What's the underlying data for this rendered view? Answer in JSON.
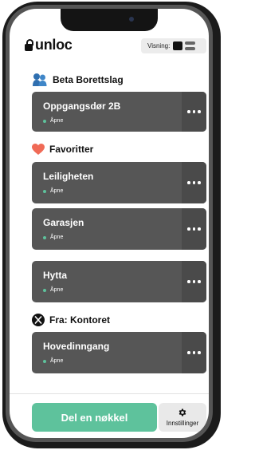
{
  "app": {
    "logo_text": "unloc"
  },
  "view_toggle": {
    "label": "Visning:",
    "selected": "grid"
  },
  "sections": [
    {
      "title": "Beta Borettslag",
      "icon": "people-icon",
      "cards": [
        {
          "name": "Oppgangsdør 2B",
          "status": "Åpne"
        }
      ]
    },
    {
      "title": "Favoritter",
      "icon": "heart-icon",
      "cards": [
        {
          "name": "Leiligheten",
          "status": "Åpne"
        },
        {
          "name": "Garasjen",
          "status": "Åpne"
        },
        {
          "name": "Hytta",
          "status": "Åpne"
        }
      ]
    },
    {
      "title": "Fra: Kontoret",
      "icon": "company-logo-icon",
      "cards": [
        {
          "name": "Hovedinngang",
          "status": "Åpne"
        }
      ]
    }
  ],
  "footer": {
    "share_label": "Del en nøkkel",
    "settings_label": "Innstillinger"
  },
  "colors": {
    "accent": "#5ec29c",
    "card": "#565656",
    "card_more": "#4a4a4a",
    "heart": "#f06a56",
    "people_icon": "#2f6fb0"
  }
}
